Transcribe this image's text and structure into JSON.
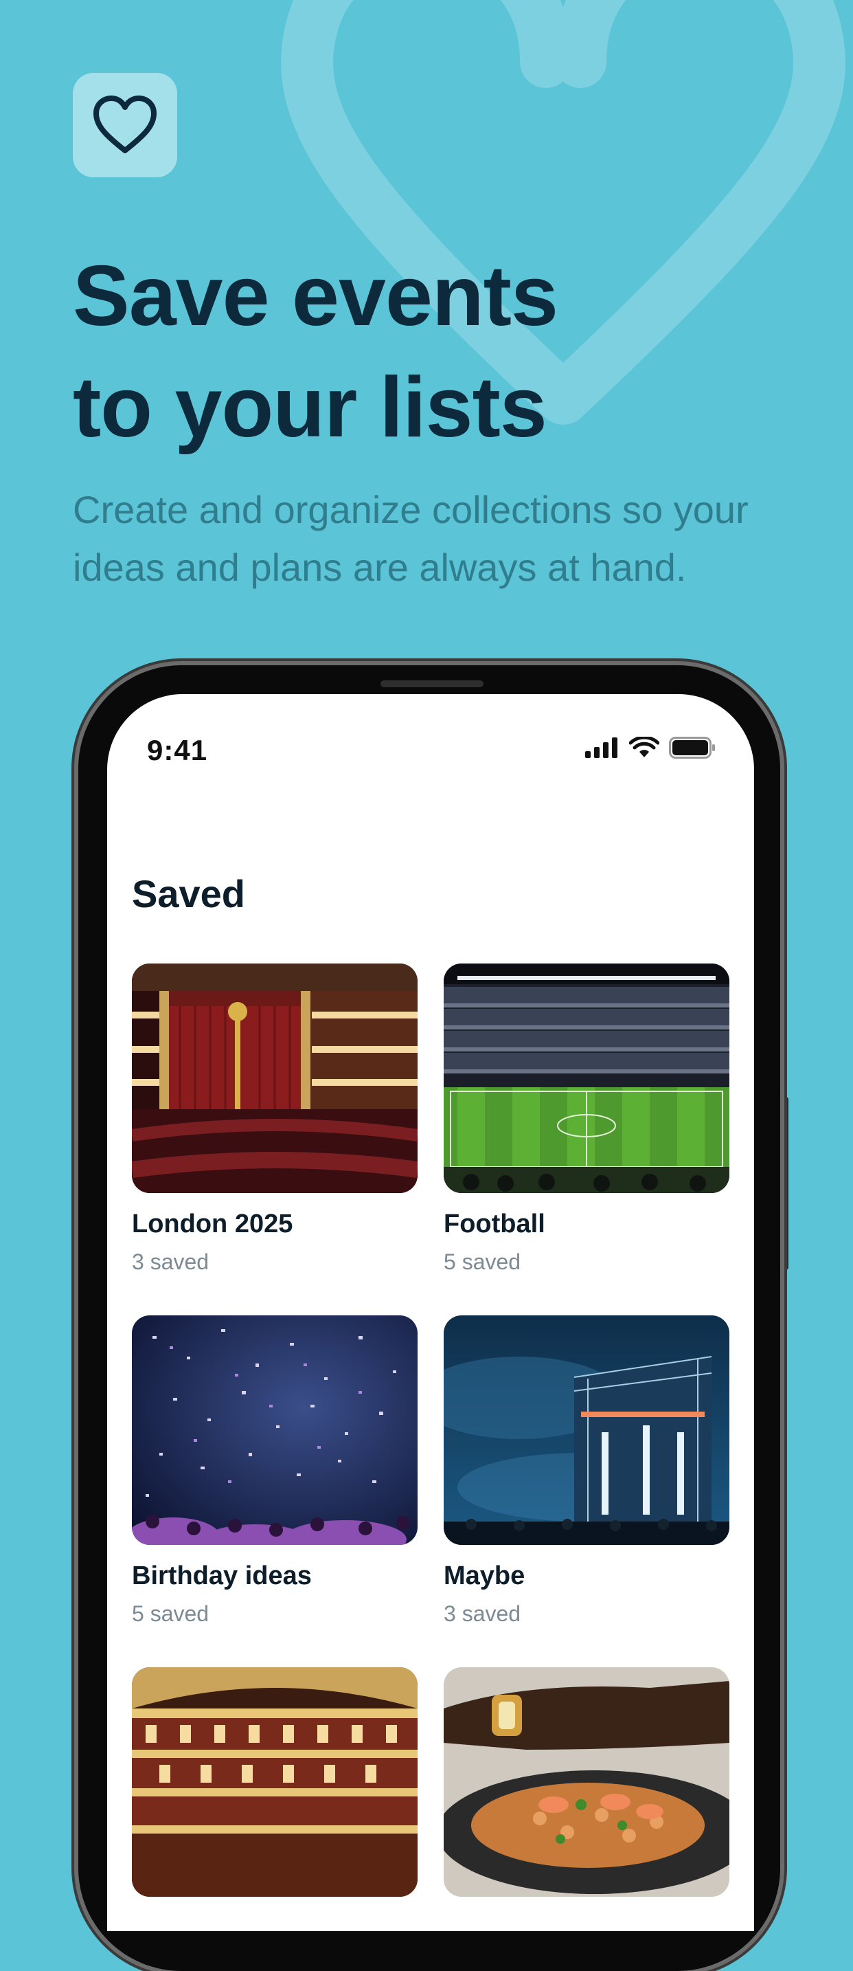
{
  "header": {
    "title_line1": "Save events",
    "title_line2": "to your lists",
    "subtitle": "Create and organize collections so your ideas and plans are always at hand."
  },
  "colors": {
    "background": "#5bc4d7",
    "title": "#0d2a3c",
    "subtitle": "#2f7d8d",
    "badge": "#a4e0ea"
  },
  "icons": {
    "badge": "heart-icon",
    "background": "heart-outline-icon"
  },
  "phone": {
    "status_time": "9:41",
    "section_title": "Saved",
    "lists": [
      {
        "name": "London 2025",
        "count": "3 saved",
        "image": "theatre-stage"
      },
      {
        "name": "Football",
        "count": "5 saved",
        "image": "football-stadium"
      },
      {
        "name": "Birthday ideas",
        "count": "5 saved",
        "image": "confetti-concert"
      },
      {
        "name": "Maybe",
        "count": "3 saved",
        "image": "festival-stage"
      },
      {
        "name": "",
        "count": "",
        "image": "opera-house"
      },
      {
        "name": "",
        "count": "",
        "image": "food-plate"
      }
    ]
  }
}
